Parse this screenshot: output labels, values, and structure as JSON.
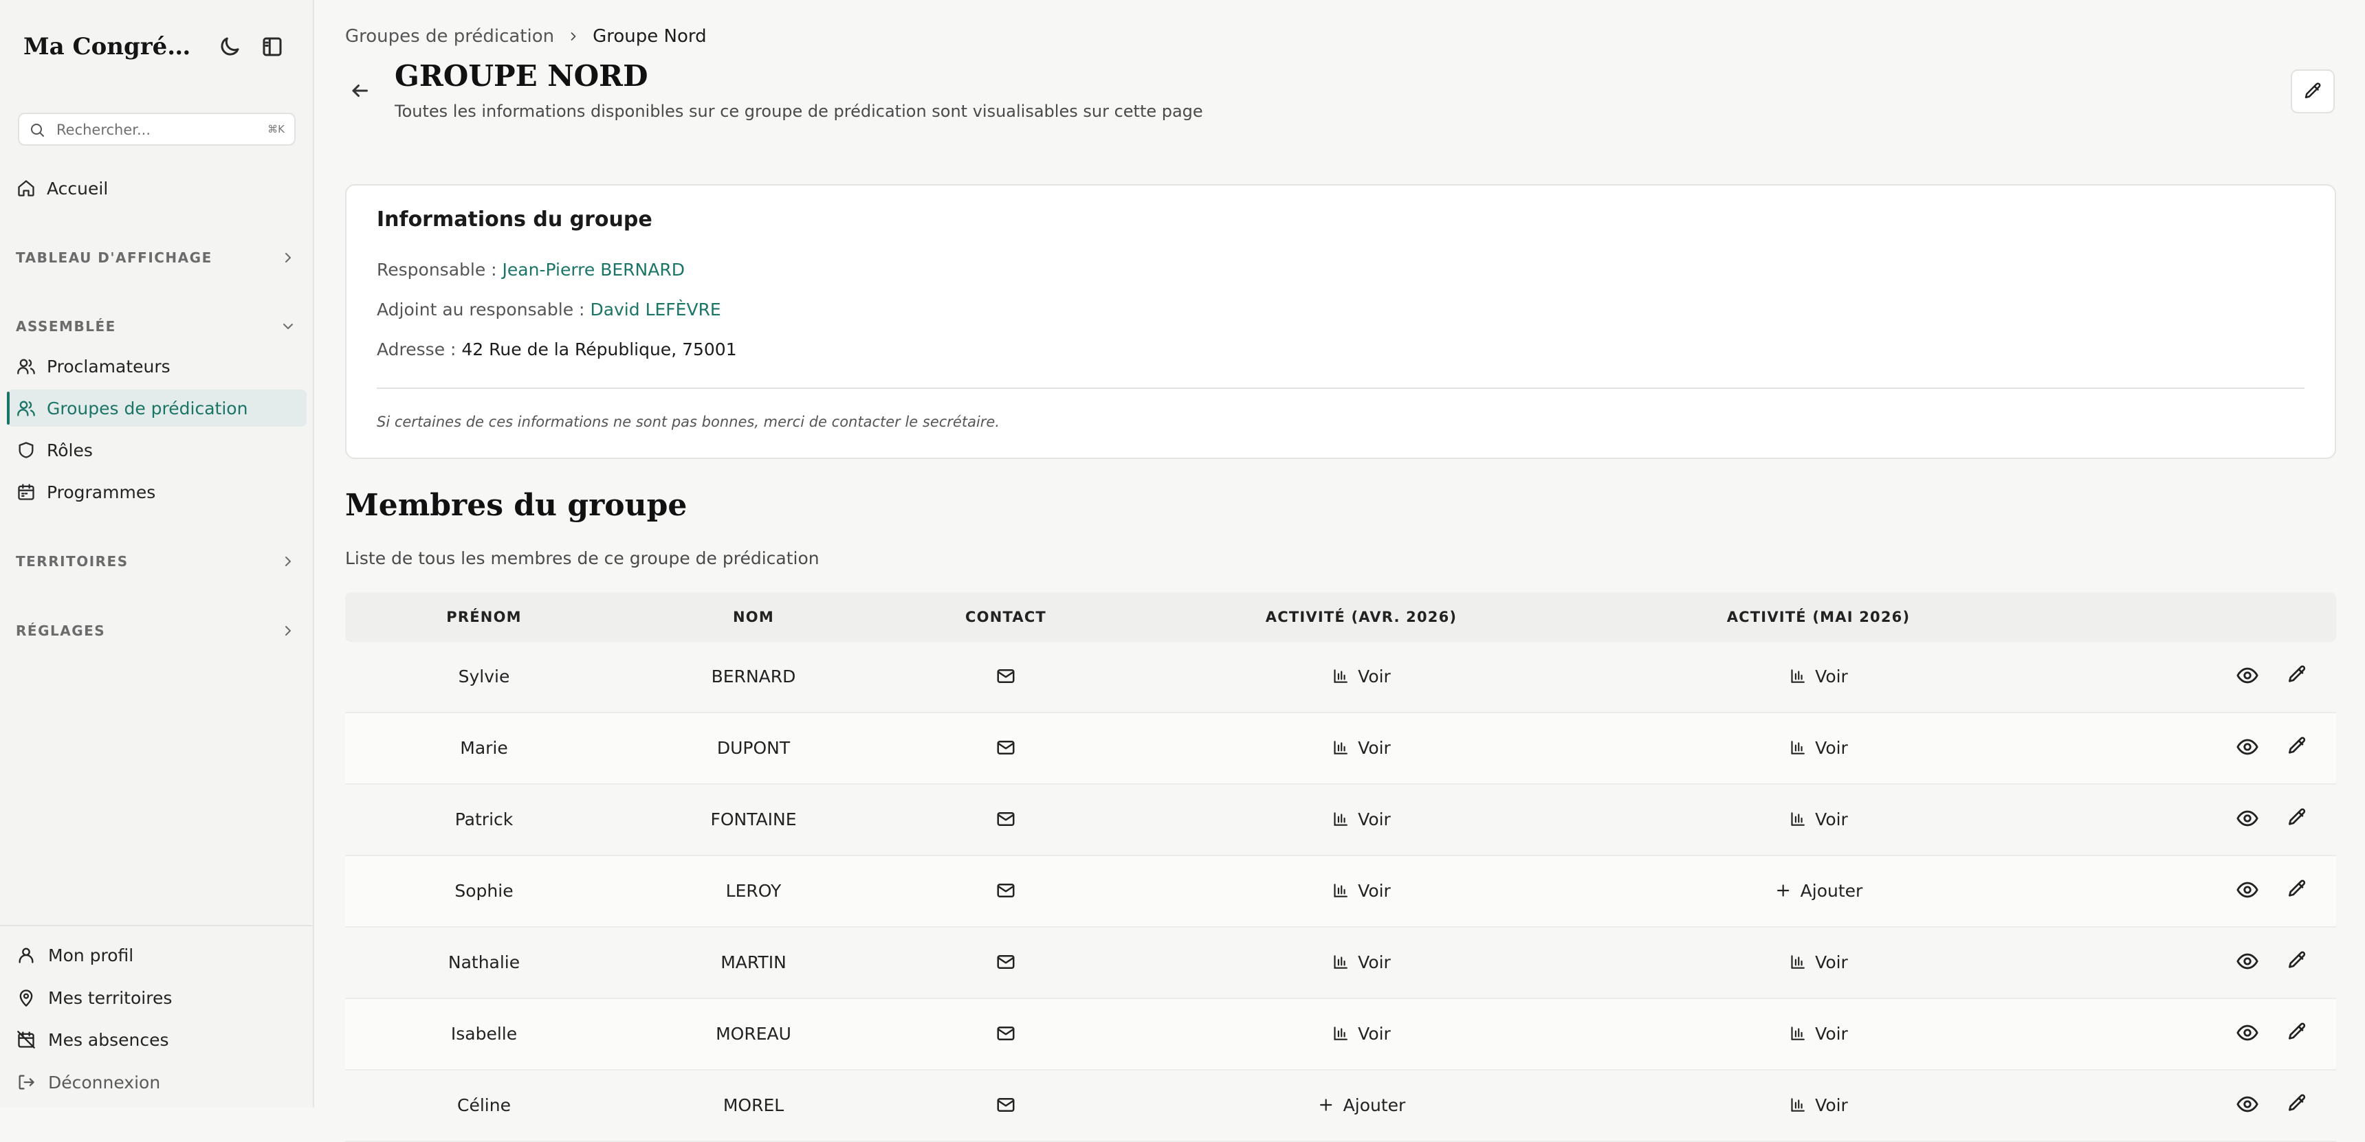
{
  "sidebar": {
    "brand": "Ma Congrégat...",
    "search_placeholder": "Rechercher...",
    "search_shortcut": "⌘K",
    "home": "Accueil",
    "sections": {
      "tableau": "TABLEAU D'AFFICHAGE",
      "assemblee": "ASSEMBLÉE",
      "territoires": "TERRITOIRES",
      "reglages": "RÉGLAGES"
    },
    "assemblee_items": [
      "Proclamateurs",
      "Groupes de prédication",
      "Rôles",
      "Programmes"
    ],
    "bottom_items": [
      "Mon profil",
      "Mes territoires",
      "Mes absences",
      "Déconnexion"
    ]
  },
  "breadcrumb": {
    "parent": "Groupes de prédication",
    "current": "Groupe Nord"
  },
  "page": {
    "title": "GROUPE NORD",
    "subtitle": "Toutes les informations disponibles sur ce groupe de prédication sont visualisables sur cette page"
  },
  "info": {
    "title": "Informations du groupe",
    "responsable_label": "Responsable :",
    "responsable": "Jean-Pierre BERNARD",
    "adjoint_label": "Adjoint au responsable :",
    "adjoint": "David LEFÈVRE",
    "adresse_label": "Adresse :",
    "adresse": "42 Rue de la République, 75001",
    "note": "Si certaines de ces informations ne sont pas bonnes, merci de contacter le secrétaire."
  },
  "members": {
    "title": "Membres du groupe",
    "subtitle": "Liste de tous les membres de ce groupe de prédication",
    "columns": [
      "PRÉNOM",
      "NOM",
      "CONTACT",
      "ACTIVITÉ (AVR. 2026)",
      "ACTIVITÉ (MAI 2026)"
    ],
    "rows": [
      {
        "prenom": "Sylvie",
        "nom": "BERNARD",
        "avr": "Voir",
        "mai": "Voir"
      },
      {
        "prenom": "Marie",
        "nom": "DUPONT",
        "avr": "Voir",
        "mai": "Voir"
      },
      {
        "prenom": "Patrick",
        "nom": "FONTAINE",
        "avr": "Voir",
        "mai": "Voir"
      },
      {
        "prenom": "Sophie",
        "nom": "LEROY",
        "avr": "Voir",
        "mai": "Ajouter"
      },
      {
        "prenom": "Nathalie",
        "nom": "MARTIN",
        "avr": "Voir",
        "mai": "Voir"
      },
      {
        "prenom": "Isabelle",
        "nom": "MOREAU",
        "avr": "Voir",
        "mai": "Voir"
      },
      {
        "prenom": "Céline",
        "nom": "MOREL",
        "avr": "Ajouter",
        "mai": "Voir"
      }
    ]
  },
  "colors": {
    "accent": "#1b7567",
    "active_bg": "#e3ecea"
  },
  "icons": [
    "moon-icon",
    "sidebar-toggle-icon",
    "search-icon",
    "home-icon",
    "users-icon",
    "shield-icon",
    "calendar-icon",
    "user-icon",
    "map-pin-icon",
    "calendar-off-icon",
    "logout-icon",
    "arrow-left-icon",
    "pencil-icon",
    "mail-icon",
    "bar-chart-icon",
    "plus-icon",
    "eye-icon"
  ]
}
